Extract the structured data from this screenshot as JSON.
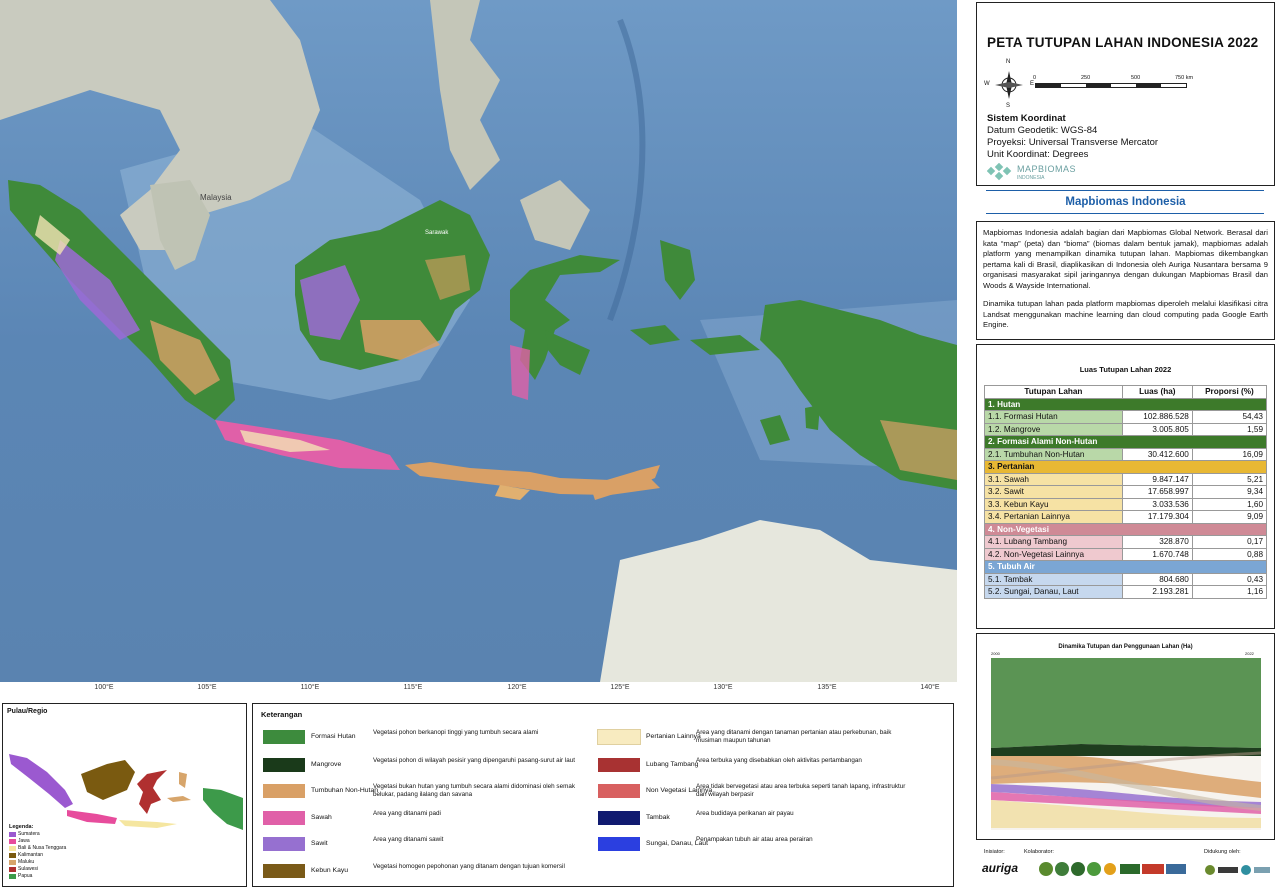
{
  "map": {
    "longitude_labels": [
      "100°E",
      "105°E",
      "110°E",
      "115°E",
      "120°E",
      "125°E",
      "130°E",
      "135°E",
      "140°E"
    ],
    "place_labels": [
      "Malaysia",
      "Sarawak"
    ]
  },
  "header": {
    "title": "PETA TUTUPAN LAHAN INDONESIA 2022",
    "compass": {
      "n": "N",
      "s": "S",
      "e": "E",
      "w": "W"
    },
    "scale_ticks": [
      "0",
      "250",
      "500",
      "750 km"
    ],
    "koordinat_heading": "Sistem Koordinat",
    "datum": "Datum Geodetik: WGS-84",
    "proyeksi": "Proyeksi: Universal Transverse Mercator",
    "unit": "Unit Koordinat: Degrees",
    "logo_text": "MAPBIOMAS",
    "logo_sub": "INDONESIA"
  },
  "about": {
    "heading": "Mapbiomas Indonesia",
    "paragraph1": "Mapbiomas Indonesia adalah bagian dari Mapbiomas Global Network. Berasal dari kata “map” (peta) dan “bioma” (biomas dalam bentuk jamak), mapbiomas adalah platform yang menampilkan dinamika tutupan lahan. Mapbiomas dikembangkan pertama kali di Brasil, diaplikasikan di Indonesia oleh Auriga Nusantara bersama 9 organisasi masyarakat sipil jaringannya dengan dukungan Mapbiomas Brasil dan Woods & Wayside International.",
    "paragraph2": "Dinamika tutupan lahan pada platform mapbiomas diperoleh melalui klasifikasi citra Landsat menggunakan machine learning dan cloud computing pada Google Earth Engine."
  },
  "table": {
    "title": "Luas Tutupan Lahan 2022",
    "headers": [
      "Tutupan Lahan",
      "Luas (ha)",
      "Proporsi (%)"
    ],
    "groups": [
      {
        "label": "1. Hutan",
        "color": "#3d7a2a",
        "text": "#ffffff",
        "rows": [
          {
            "name": "1.1. Formasi Hutan",
            "luas": "102.886.528",
            "prop": "54,43"
          },
          {
            "name": "1.2. Mangrove",
            "luas": "3.005.805",
            "prop": "1,59"
          }
        ]
      },
      {
        "label": "2. Formasi Alami Non-Hutan",
        "color": "#3d7a2a",
        "text": "#ffffff",
        "rows": [
          {
            "name": "2.1. Tumbuhan Non-Hutan",
            "luas": "30.412.600",
            "prop": "16,09"
          }
        ]
      },
      {
        "label": "3. Pertanian",
        "color": "#e8b834",
        "text": "#111111",
        "rows": [
          {
            "name": "3.1. Sawah",
            "luas": "9.847.147",
            "prop": "5,21"
          },
          {
            "name": "3.2. Sawit",
            "luas": "17.658.997",
            "prop": "9,34"
          },
          {
            "name": "3.3. Kebun Kayu",
            "luas": "3.033.536",
            "prop": "1,60"
          },
          {
            "name": "3.4. Pertanian Lainnya",
            "luas": "17.179.304",
            "prop": "9,09"
          }
        ]
      },
      {
        "label": "4. Non-Vegetasi",
        "color": "#cf8a96",
        "text": "#ffffff",
        "rows": [
          {
            "name": "4.1. Lubang Tambang",
            "luas": "328.870",
            "prop": "0,17"
          },
          {
            "name": "4.2. Non-Vegetasi Lainnya",
            "luas": "1.670.748",
            "prop": "0,88"
          }
        ]
      },
      {
        "label": "5. Tubuh Air",
        "color": "#7ba6d4",
        "text": "#ffffff",
        "rows": [
          {
            "name": "5.1. Tambak",
            "luas": "804.680",
            "prop": "0,43"
          },
          {
            "name": "5.2. Sungai, Danau, Laut",
            "luas": "2.193.281",
            "prop": "1,16"
          }
        ]
      }
    ],
    "row_fills": [
      "#b9d8a8",
      "#b9d8a8",
      "#b9d8a8",
      "#f6e2a4",
      "#f6e2a4",
      "#f6e2a4",
      "#f6e2a4",
      "#efc9cf",
      "#efc9cf",
      "#c6d8ee",
      "#c6d8ee"
    ]
  },
  "sankey": {
    "title": "Dinamika Tutupan dan Penggunaan Lahan (Ha)",
    "left_year": "2000",
    "right_year": "2022"
  },
  "footer": {
    "inisiator_label": "Inisiator:",
    "inisiator_logo": "auriga",
    "kolaborator_label": "Kolaborator:",
    "didukung_label": "Didukung oleh:"
  },
  "region": {
    "title": "Pulau/Regio",
    "legend_title": "Legenda:",
    "items": [
      {
        "name": "Sumatera",
        "color": "#9b59d0"
      },
      {
        "name": "Jawa",
        "color": "#e74c9c"
      },
      {
        "name": "Bali & Nusa Tenggara",
        "color": "#f5e6a0"
      },
      {
        "name": "Kalimantan",
        "color": "#7a5a10"
      },
      {
        "name": "Maluku",
        "color": "#d7a56b"
      },
      {
        "name": "Sulawesi",
        "color": "#b03030"
      },
      {
        "name": "Papua",
        "color": "#3d9a4a"
      }
    ]
  },
  "keterangan": {
    "title": "Keterangan",
    "items": [
      {
        "name": "Formasi Hutan",
        "color": "#3d8b3d",
        "desc": "Vegetasi pohon berkanopi tinggi yang tumbuh secara alami"
      },
      {
        "name": "Mangrove",
        "color": "#1a3a1a",
        "desc": "Vegetasi pohon di wilayah pesisir yang dipengaruhi pasang-surut air laut"
      },
      {
        "name": "Tumbuhan Non-Hutan",
        "color": "#d9a066",
        "desc": "Vegetasi bukan hutan yang tumbuh secara alami didominasi oleh semak belukar, padang ilalang dan savana"
      },
      {
        "name": "Sawah",
        "color": "#e060a8",
        "desc": "Area yang ditanami padi"
      },
      {
        "name": "Sawit",
        "color": "#9670d0",
        "desc": "Area yang ditanami sawit"
      },
      {
        "name": "Kebun Kayu",
        "color": "#7a5a18",
        "desc": "Vegetasi homogen pepohonan yang ditanam dengan tujuan komersil"
      },
      {
        "name": "Pertanian Lainnya",
        "color": "#f8ebc0",
        "desc": "Area yang ditanami dengan tanaman pertanian atau perkebunan, baik musiman maupun tahunan"
      },
      {
        "name": "Lubang Tambang",
        "color": "#a83232",
        "desc": "Area terbuka yang disebabkan oleh aktivitas pertambangan"
      },
      {
        "name": "Non Vegetasi Lainnya",
        "color": "#d86060",
        "desc": "Area tidak bervegetasi atau area terbuka seperti tanah lapang, infrastruktur dan wilayah berpasir"
      },
      {
        "name": "Tambak",
        "color": "#101a70",
        "desc": "Area budidaya perikanan air payau"
      },
      {
        "name": "Sungai, Danau, Laut",
        "color": "#2b3fe0",
        "desc": "Penampakan tubuh air atau area perairan"
      }
    ]
  }
}
